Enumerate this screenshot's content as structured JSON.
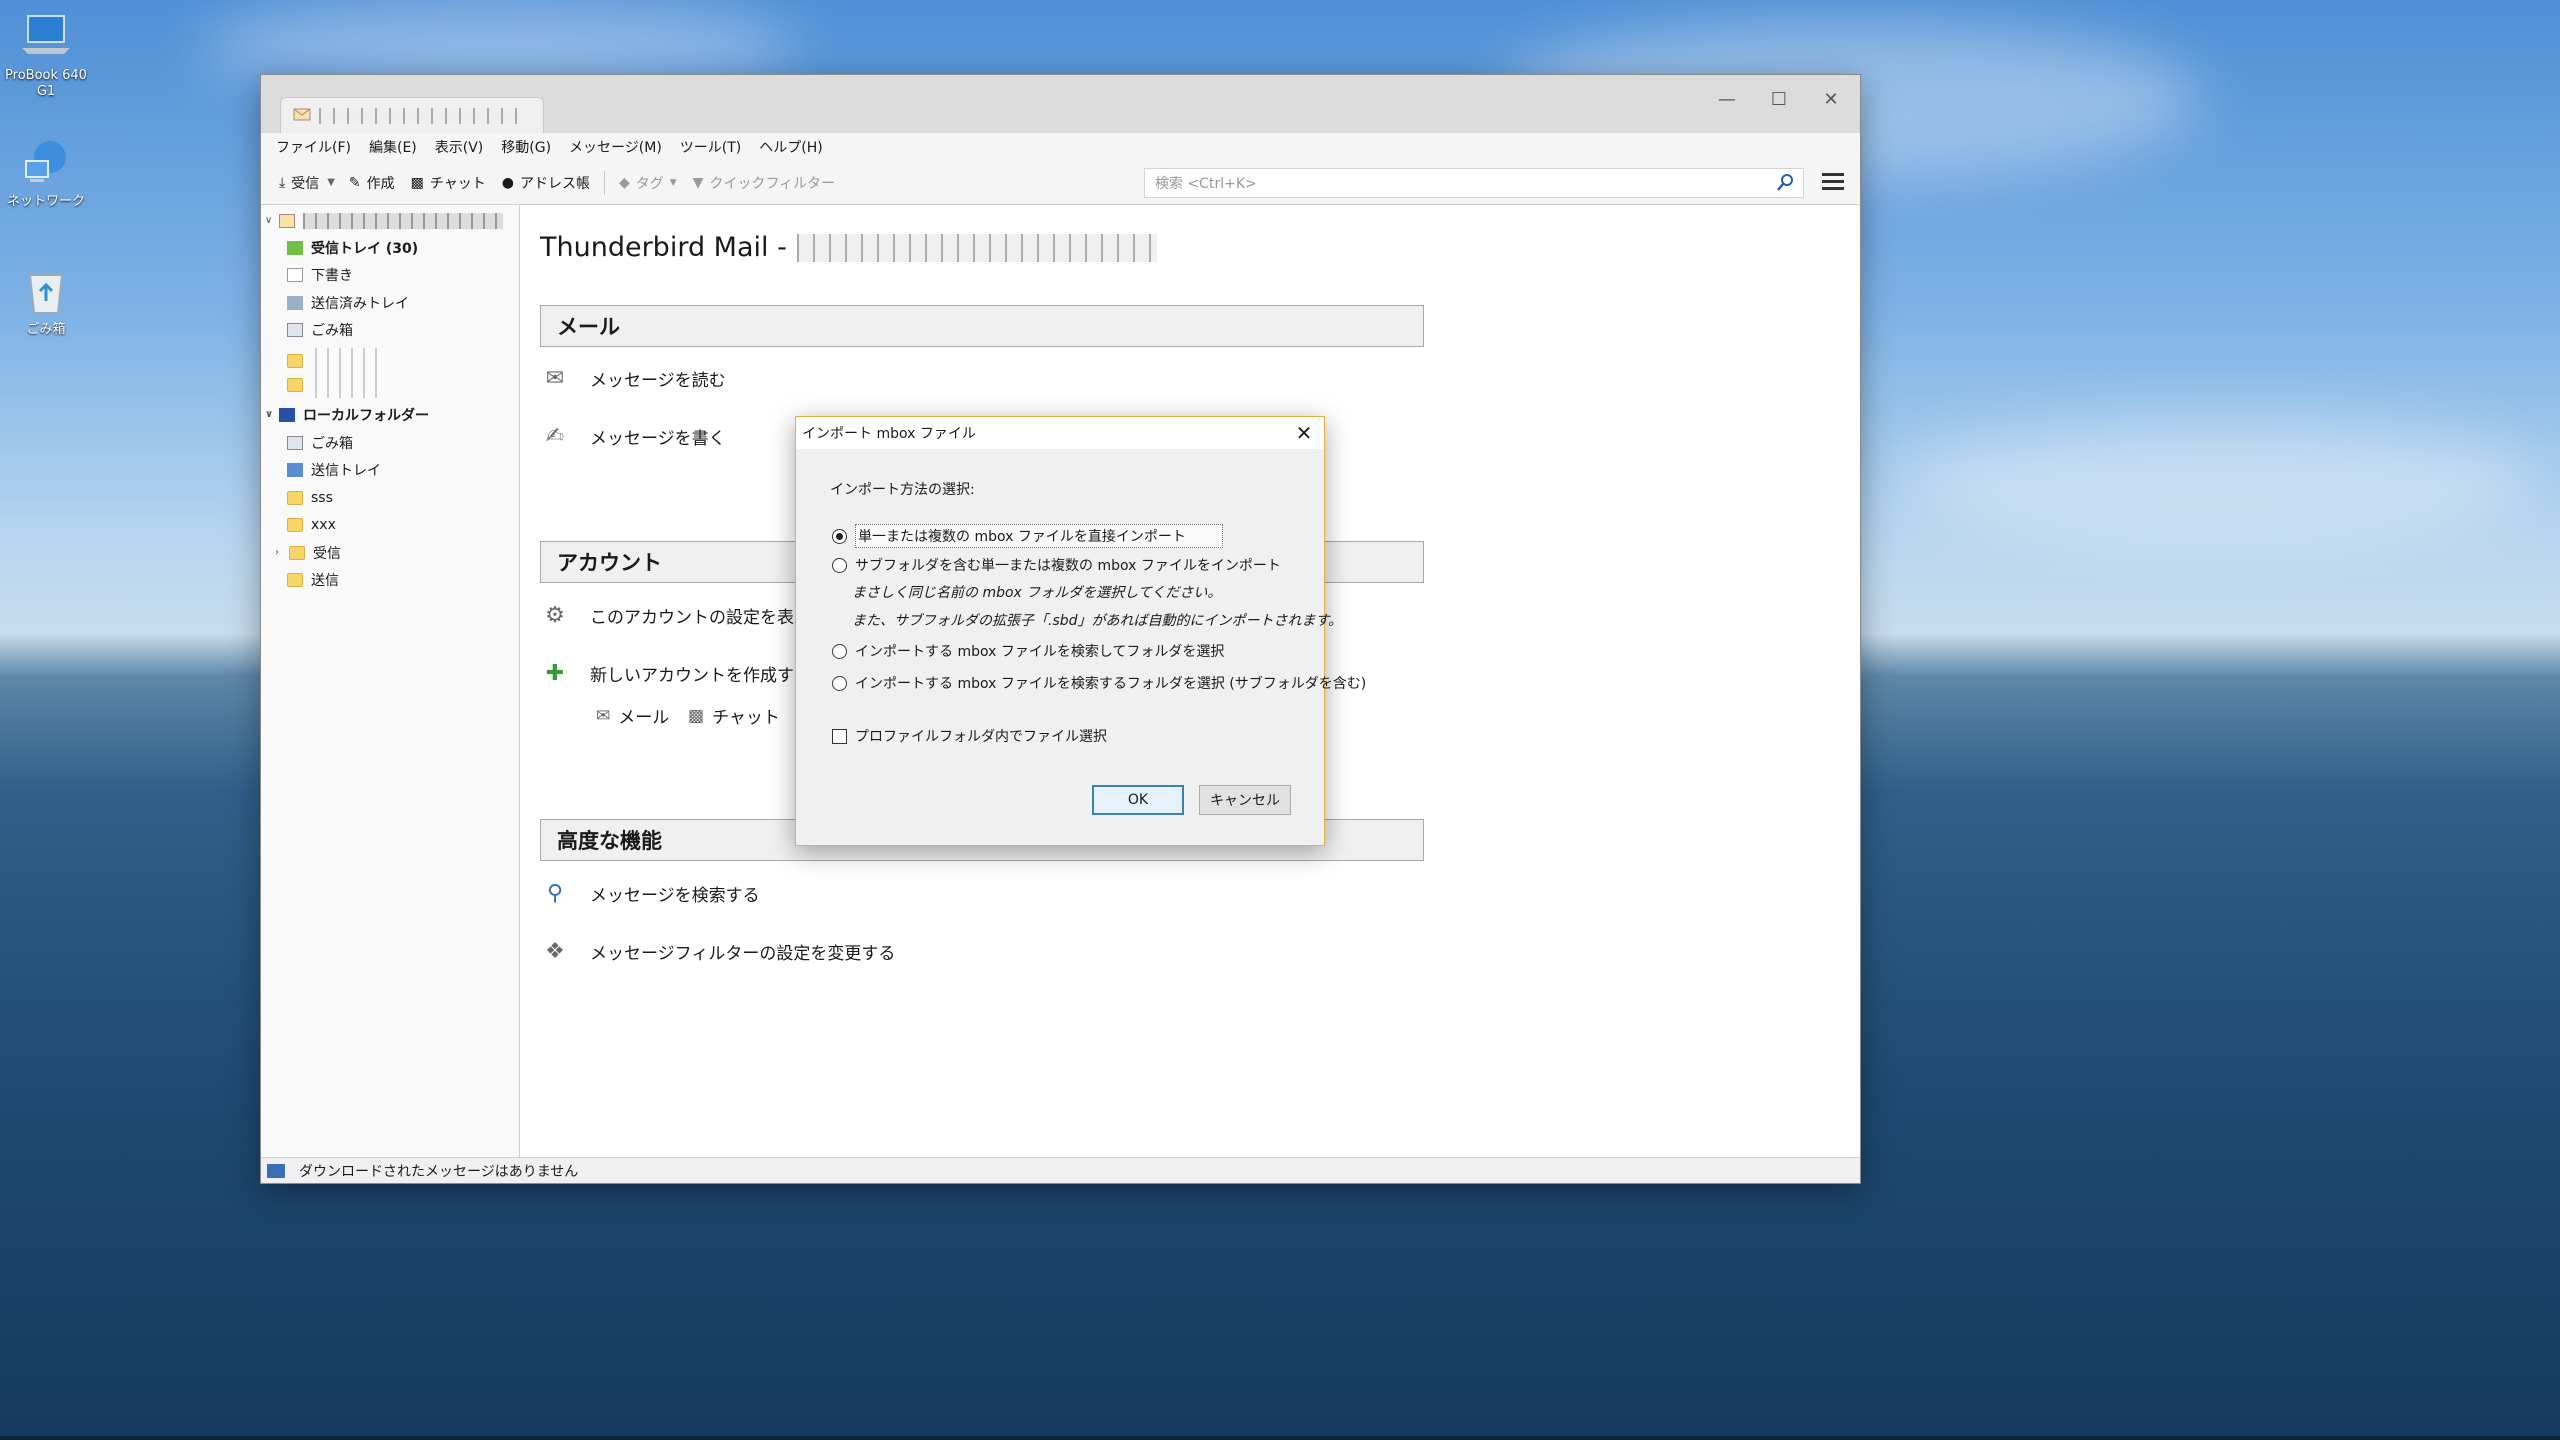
{
  "desktop": {
    "icons": [
      {
        "label": "ProBook 640 G1"
      },
      {
        "label": "ネットワーク"
      },
      {
        "label": "ごみ箱"
      }
    ]
  },
  "window": {
    "tab_title": "",
    "menu": [
      "ファイル(F)",
      "編集(E)",
      "表示(V)",
      "移動(G)",
      "メッセージ(M)",
      "ツール(T)",
      "ヘルプ(H)"
    ],
    "toolbar": {
      "receive": "受信",
      "compose": "作成",
      "chat": "チャット",
      "address_book": "アドレス帳",
      "tag": "タグ",
      "quick_filter": "クイックフィルター"
    },
    "search_placeholder": "検索 <Ctrl+K>"
  },
  "folders": {
    "account": {
      "inbox": "受信トレイ (30)",
      "drafts": "下書き",
      "sent": "送信済みトレイ",
      "trash": "ごみ箱"
    },
    "local": {
      "title": "ローカルフォルダー",
      "trash": "ごみ箱",
      "outbox": "送信トレイ",
      "sss": "sss",
      "xxx": "xxx",
      "inbox": "受信",
      "send": "送信"
    }
  },
  "content": {
    "title": "Thunderbird Mail -",
    "mail_section": "メール",
    "read_messages": "メッセージを読む",
    "write_message": "メッセージを書く",
    "accounts_section": "アカウント",
    "view_settings": "このアカウントの設定を表示",
    "new_account": "新しいアカウントを作成する",
    "new_mail": "メール",
    "new_chat": "チャット",
    "advanced_section": "高度な機能",
    "search_messages": "メッセージを検索する",
    "filter_settings": "メッセージフィルターの設定を変更する"
  },
  "status": {
    "text": "ダウンロードされたメッセージはありません"
  },
  "dialog": {
    "title": "インポート mbox ファイル",
    "prompt": "インポート方法の選択:",
    "opt1": "単一または複数の mbox ファイルを直接インポート",
    "opt2": "サブフォルダを含む単一または複数の mbox ファイルをインポート",
    "note1": "まさしく同じ名前の mbox フォルダを選択してください。",
    "note2": "また、サブフォルダの拡張子「.sbd」があれば自動的にインポートされます。",
    "opt3": "インポートする mbox ファイルを検索してフォルダを選択",
    "opt4": "インポートする mbox ファイルを検索するフォルダを選択 (サブフォルダを含む)",
    "profile_check": "プロファイルフォルダ内でファイル選択",
    "ok": "OK",
    "cancel": "キャンセル",
    "selected_option": 1
  },
  "colors": {
    "dialog_border": "#e8b040",
    "default_button_border": "#3c7fb1"
  }
}
